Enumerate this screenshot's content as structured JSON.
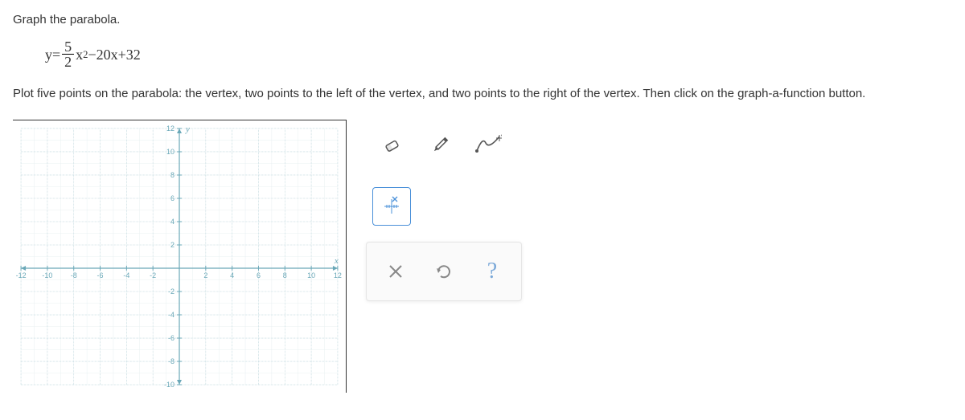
{
  "problem": {
    "intro": "Graph the parabola.",
    "equation": {
      "lhs": "y=",
      "frac_num": "5",
      "frac_den": "2",
      "after_frac": "x",
      "exponent": "2",
      "tail": "−20x+32"
    },
    "instructions": "Plot five points on the parabola: the vertex, two points to the left of the vertex, and two points to the right of the vertex. Then click on the graph-a-function button."
  },
  "graph": {
    "x_label": "x",
    "y_label": "y",
    "x_min": -12,
    "x_max": 12,
    "y_min": -10,
    "y_max": 12,
    "x_ticks": [
      -12,
      -10,
      -8,
      -6,
      -4,
      -2,
      2,
      4,
      6,
      8,
      10,
      12
    ],
    "y_ticks": [
      -10,
      -8,
      -6,
      -4,
      -2,
      2,
      4,
      6,
      8,
      10,
      12
    ]
  },
  "tools": {
    "eraser": "eraser-icon",
    "pencil": "pencil-icon",
    "curve": "graph-function-icon",
    "point_tool": "point-tool-icon",
    "close": "×",
    "undo": "↺",
    "help": "?"
  },
  "chart_data": {
    "type": "scatter",
    "title": "",
    "xlabel": "x",
    "ylabel": "y",
    "xlim": [
      -12,
      12
    ],
    "ylim": [
      -10,
      12
    ],
    "x": [],
    "y": []
  }
}
